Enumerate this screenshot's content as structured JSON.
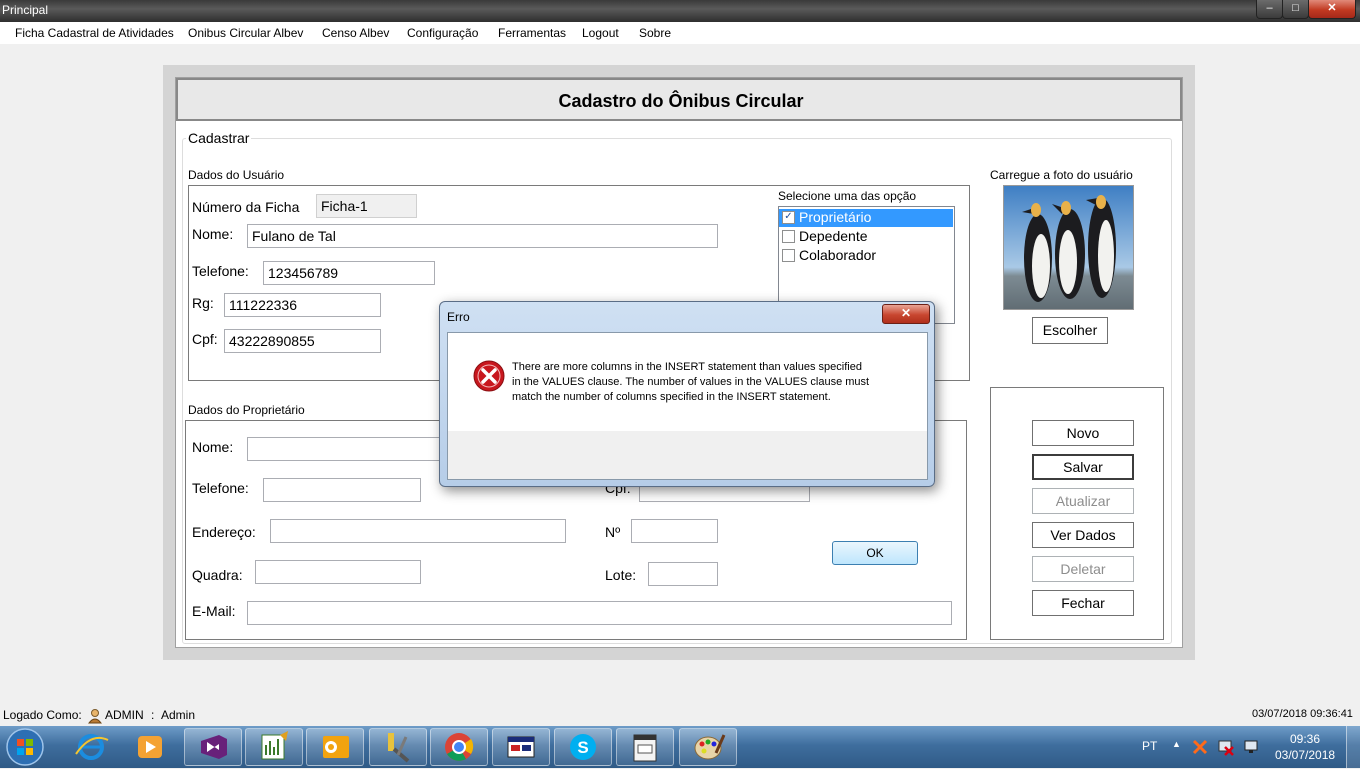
{
  "window": {
    "title": "Principal",
    "minimize": "–",
    "maximize": "□",
    "close": "✕"
  },
  "menu": [
    "Ficha Cadastral de Atividades",
    "Onibus Circular Albev",
    "Censo Albev",
    "Configuração",
    "Ferramentas",
    "Logout",
    "Sobre"
  ],
  "form": {
    "title": "Cadastro do Ônibus Circular",
    "group_label": "Cadastrar",
    "usuario": {
      "section_label": "Dados do Usuário",
      "numero_label": "Número da Ficha",
      "numero_value": "Ficha-1",
      "nome_label": "Nome:",
      "nome_value": "Fulano de Tal",
      "telefone_label": "Telefone:",
      "telefone_value": "123456789",
      "rg_label": "Rg:",
      "rg_value": "111222336",
      "cpf_label": "Cpf:",
      "cpf_value": "43222890855"
    },
    "opcoes": {
      "label": "Selecione uma das opção",
      "items": [
        {
          "label": "Proprietário",
          "checked": true
        },
        {
          "label": "Depedente",
          "checked": false
        },
        {
          "label": "Colaborador",
          "checked": false
        }
      ]
    },
    "foto": {
      "label": "Carregue a foto do usuário",
      "button": "Escolher"
    },
    "proprietario": {
      "section_label": "Dados do Proprietário",
      "nome_label": "Nome:",
      "telefone_label": "Telefone:",
      "cpf_label": "Cpf:",
      "endereco_label": "Endereço:",
      "numero_label": "Nº",
      "quadra_label": "Quadra:",
      "lote_label": "Lote:",
      "email_label": "E-Mail:"
    },
    "actions": {
      "novo": "Novo",
      "salvar": "Salvar",
      "atualizar": "Atualizar",
      "ver_dados": "Ver Dados",
      "deletar": "Deletar",
      "fechar": "Fechar"
    }
  },
  "dialog": {
    "title": "Erro",
    "message_line1": "There are more columns in the INSERT statement than values specified",
    "message_line2": "in the VALUES clause. The number of values in the VALUES clause must",
    "message_line3": "match the number of columns specified in the INSERT statement.",
    "ok": "OK",
    "close": "✕"
  },
  "status": {
    "logged_label": "Logado Como:",
    "user": "ADMIN",
    "separator": ":",
    "role": "Admin",
    "datetime": "03/07/2018 09:36:41"
  },
  "taskbar": {
    "lang": "PT",
    "time": "09:36",
    "date": "03/07/2018",
    "apps": [
      "internet-explorer-icon",
      "media-player-icon",
      "visual-studio-icon",
      "project-icon",
      "outlook-icon",
      "tools-icon",
      "chrome-icon",
      "app-window-icon",
      "skype-icon",
      "app-form-icon",
      "paint-icon"
    ]
  },
  "colors": {
    "selection": "#3399ff",
    "error": "#c8171e",
    "taskbar": "#3f6e9e"
  }
}
